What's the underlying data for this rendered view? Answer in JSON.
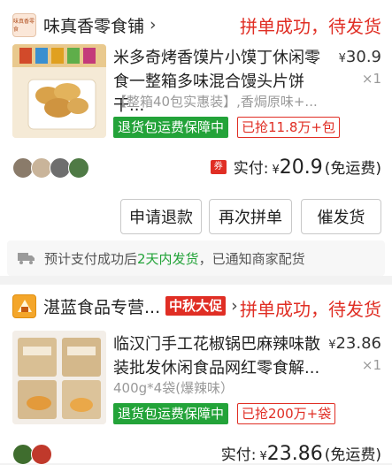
{
  "orders": [
    {
      "shop_name": "味真香零食铺",
      "shop_logo_text": "味真香零食",
      "status": "拼单成功，待发货",
      "title": "米多奇烤香馍片小馍丁休闲零食一整箱多味混合馒头片饼干...",
      "title_line1": "米多奇烤香馍片小馍丁休闲零",
      "title_line2": "食一整箱多味混合馒头片饼干...",
      "price_symbol": "¥",
      "price": "30.9",
      "qty": "×1",
      "spec": "【整箱40包实惠装】,香焗原味+...",
      "tags": [
        "退货包运费保障中",
        "已抢11.8万+包"
      ],
      "paid_label": "实付:",
      "paid_symbol": "¥",
      "paid_amount": "20.9",
      "paid_note": "(免运费)",
      "coupon_icon_text": "券",
      "buttons": [
        "申请退款",
        "再次拼单",
        "催发货"
      ],
      "notice_prefix": "预计支付成功后",
      "notice_highlight": "2天内发货",
      "notice_suffix": "，已通知商家配货"
    },
    {
      "shop_name": "湛蓝食品专营...",
      "promo_badge": "中秋大促",
      "status": "拼单成功，待发货",
      "title_line1": "临汉门手工花椒锅巴麻辣味散",
      "title_line2": "装批发休闲食品网红零食解...",
      "price_symbol": "¥",
      "price": "23.86",
      "qty": "×1",
      "spec": "400g*4袋(爆辣味）",
      "tags": [
        "退货包运费保障中",
        "已抢200万+袋"
      ],
      "paid_label": "实付:",
      "paid_symbol": "¥",
      "paid_amount": "23.86",
      "paid_note": "(免运费)"
    }
  ],
  "colors": {
    "accent_red": "#e02e24",
    "green": "#23a339"
  }
}
